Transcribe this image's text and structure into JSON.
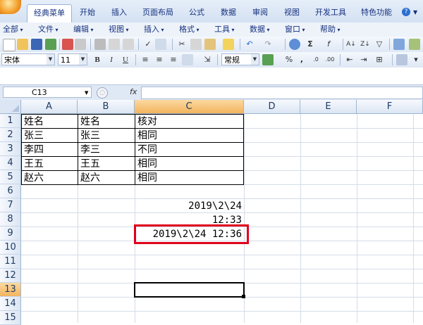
{
  "ribbon": {
    "tabs": [
      "经典菜单",
      "开始",
      "插入",
      "页面布局",
      "公式",
      "数据",
      "审阅",
      "视图",
      "开发工具",
      "特色功能"
    ],
    "active_tab": "经典菜单",
    "help": "?"
  },
  "menubar": [
    "全部",
    "文件",
    "编辑",
    "视图",
    "插入",
    "格式",
    "工具",
    "数据",
    "窗口",
    "帮助"
  ],
  "toolbar2": {
    "font": "宋体",
    "size": "11",
    "bold": "B",
    "italic": "I",
    "underline": "U",
    "number_format": "常规",
    "percent": "%",
    "comma": ","
  },
  "formula_bar": {
    "name_box": "C13",
    "fx": "fx",
    "formula": ""
  },
  "sheet": {
    "columns": [
      "A",
      "B",
      "C",
      "D",
      "E",
      "F"
    ],
    "rows": [
      "1",
      "2",
      "3",
      "4",
      "5",
      "6",
      "7",
      "8",
      "9",
      "10",
      "11",
      "12",
      "13",
      "14",
      "15"
    ],
    "table": [
      [
        "姓名",
        "姓名",
        "核对"
      ],
      [
        "张三",
        "张三",
        "相同"
      ],
      [
        "李四",
        "李三",
        "不同"
      ],
      [
        "王五",
        "王五",
        "相同"
      ],
      [
        "赵六",
        "赵六",
        "相同"
      ]
    ],
    "c7": "2019\\2\\24",
    "c8": "12:33",
    "c9": "2019\\2\\24 12:36",
    "selected_cell": "C13",
    "highlight_color": "#e0001b"
  }
}
